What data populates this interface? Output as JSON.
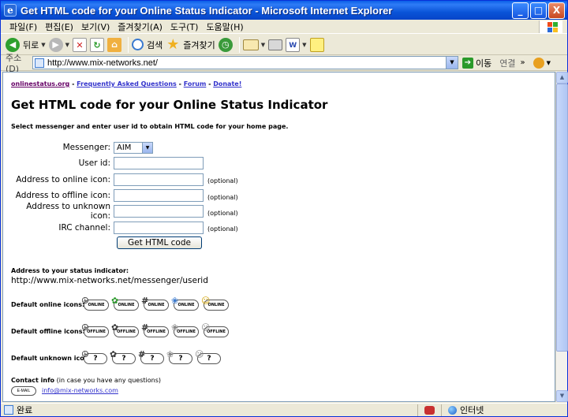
{
  "window": {
    "title": "Get HTML code for your Online Status Indicator - Microsoft Internet Explorer",
    "buttons": {
      "minimize": "_",
      "maximize": "□",
      "close": "X"
    }
  },
  "menubar": [
    "파일(F)",
    "편집(E)",
    "보기(V)",
    "즐겨찾기(A)",
    "도구(T)",
    "도움말(H)"
  ],
  "toolbar": {
    "back": "뒤로",
    "search": "검색",
    "favorites": "즐겨찾기"
  },
  "addressbar": {
    "label": "주소(D)",
    "url": "http://www.mix-networks.net/",
    "go": "이동",
    "links": "연결"
  },
  "page": {
    "toplinks": [
      "onlinestatus.org",
      "Frequently Asked Questions",
      "Forum",
      "Donate!"
    ],
    "separator": " - ",
    "title": "Get HTML code for your Online Status Indicator",
    "intro": "Select messenger and enter user id to obtain HTML code for your home page.",
    "form": {
      "messenger_label": "Messenger:",
      "messenger_value": "AIM",
      "userid_label": "User id:",
      "online_label": "Address to online icon:",
      "offline_label": "Address to offline icon:",
      "unknown_label": "Address to unknown icon:",
      "irc_label": "IRC channel:",
      "optional": "(optional)",
      "submit": "Get HTML code"
    },
    "status_address_label": "Address to your status indicator:",
    "status_address": "http://www.mix-networks.net/messenger/userid",
    "online_icons_label": "Default online icons:",
    "offline_icons_label": "Default offline icons:",
    "unknown_icons_label": "Default unknown icons:",
    "icon_online_text": "ONLINE",
    "icon_offline_text": "OFFLINE",
    "icon_unknown_text": "?",
    "contact_label": "Contact info",
    "contact_note": " (in case you have any questions)",
    "email_icon_text": "E-MAIL",
    "email": "info@mix-networks.com"
  },
  "statusbar": {
    "text": "완료",
    "zone": "인터넷"
  },
  "colors": {
    "titlebar": "#0a54d8",
    "chrome": "#ece9d8",
    "link": "#3333cc"
  }
}
